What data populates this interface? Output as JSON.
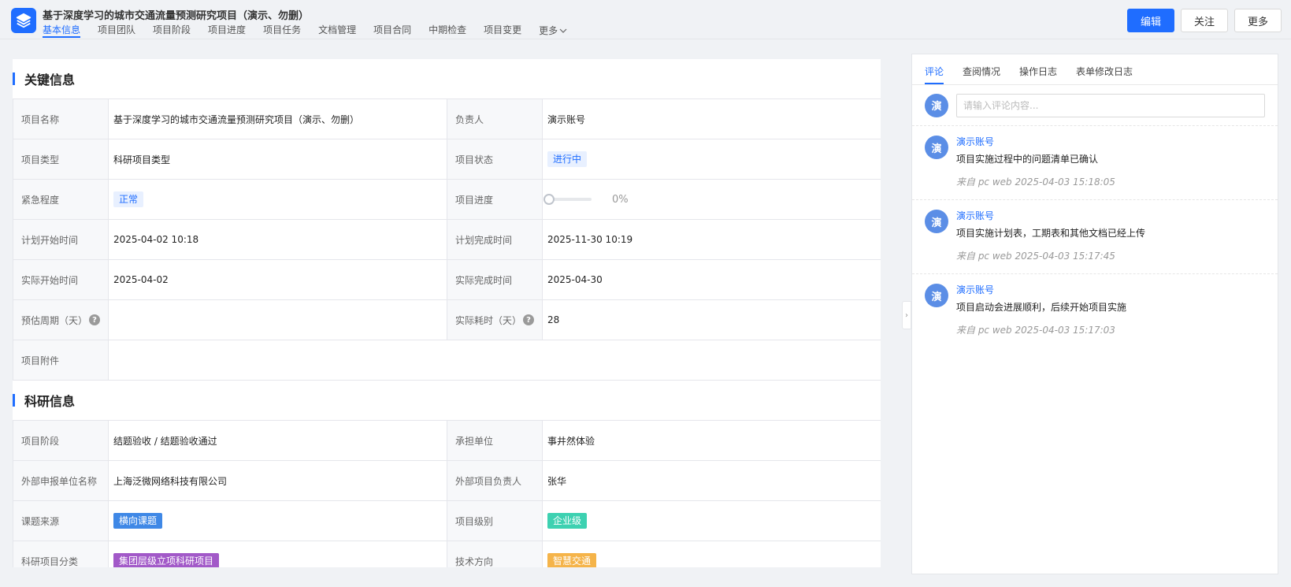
{
  "header": {
    "title": "基于深度学习的城市交通流量预测研究项目（演示、勿删）",
    "tabs": [
      {
        "label": "基本信息",
        "active": true
      },
      {
        "label": "项目团队"
      },
      {
        "label": "项目阶段"
      },
      {
        "label": "项目进度"
      },
      {
        "label": "项目任务"
      },
      {
        "label": "文档管理"
      },
      {
        "label": "项目合同"
      },
      {
        "label": "中期检查"
      },
      {
        "label": "项目变更"
      }
    ],
    "more_label": "更多",
    "buttons": {
      "edit": "编辑",
      "follow": "关注",
      "more": "更多"
    },
    "accent": "#1f6dff"
  },
  "key_info": {
    "title": "关键信息",
    "project_name_label": "项目名称",
    "project_name": "基于深度学习的城市交通流量预测研究项目（演示、勿删）",
    "owner_label": "负责人",
    "owner": "演示账号",
    "type_label": "项目类型",
    "type": "科研项目类型",
    "status_label": "项目状态",
    "status": "进行中",
    "urgency_label": "紧急程度",
    "urgency": "正常",
    "progress_label": "项目进度",
    "progress_value": 0,
    "progress_text": "0%",
    "plan_start_label": "计划开始时间",
    "plan_start": "2025-04-02 10:18",
    "plan_end_label": "计划完成时间",
    "plan_end": "2025-11-30 10:19",
    "actual_start_label": "实际开始时间",
    "actual_start": "2025-04-02",
    "actual_end_label": "实际完成时间",
    "actual_end": "2025-04-30",
    "est_days_label": "预估周期（天）",
    "est_days": "",
    "actual_days_label": "实际耗时（天）",
    "actual_days": "28",
    "attachment_label": "项目附件",
    "attachment": ""
  },
  "research_info": {
    "title": "科研信息",
    "stage_label": "项目阶段",
    "stage": "结题验收 / 结题验收通过",
    "unit_label": "承担单位",
    "unit": "事井然体验",
    "ext_unit_label": "外部申报单位名称",
    "ext_unit": "上海泛微网络科技有限公司",
    "ext_owner_label": "外部项目负责人",
    "ext_owner": "张华",
    "source_label": "课题来源",
    "source": "横向课题",
    "level_label": "项目级别",
    "level": "企业级",
    "category_label": "科研项目分类",
    "category": "集团层级立项科研项目",
    "direction_label": "技术方向",
    "direction": "智慧交通"
  },
  "side": {
    "tabs": [
      {
        "label": "评论",
        "active": true
      },
      {
        "label": "查阅情况"
      },
      {
        "label": "操作日志"
      },
      {
        "label": "表单修改日志"
      }
    ],
    "avatar_char": "演",
    "input_placeholder": "请输入评论内容...",
    "comments": [
      {
        "author": "演示账号",
        "text": "项目实施过程中的问题清单已确认",
        "meta": "来自 pc web 2025-04-03 15:18:05"
      },
      {
        "author": "演示账号",
        "text": "项目实施计划表，工期表和其他文档已经上传",
        "meta": "来自 pc web 2025-04-03 15:17:45"
      },
      {
        "author": "演示账号",
        "text": "项目启动会进展顺利，后续开始项目实施",
        "meta": "来自 pc web 2025-04-03 15:17:03"
      }
    ]
  }
}
